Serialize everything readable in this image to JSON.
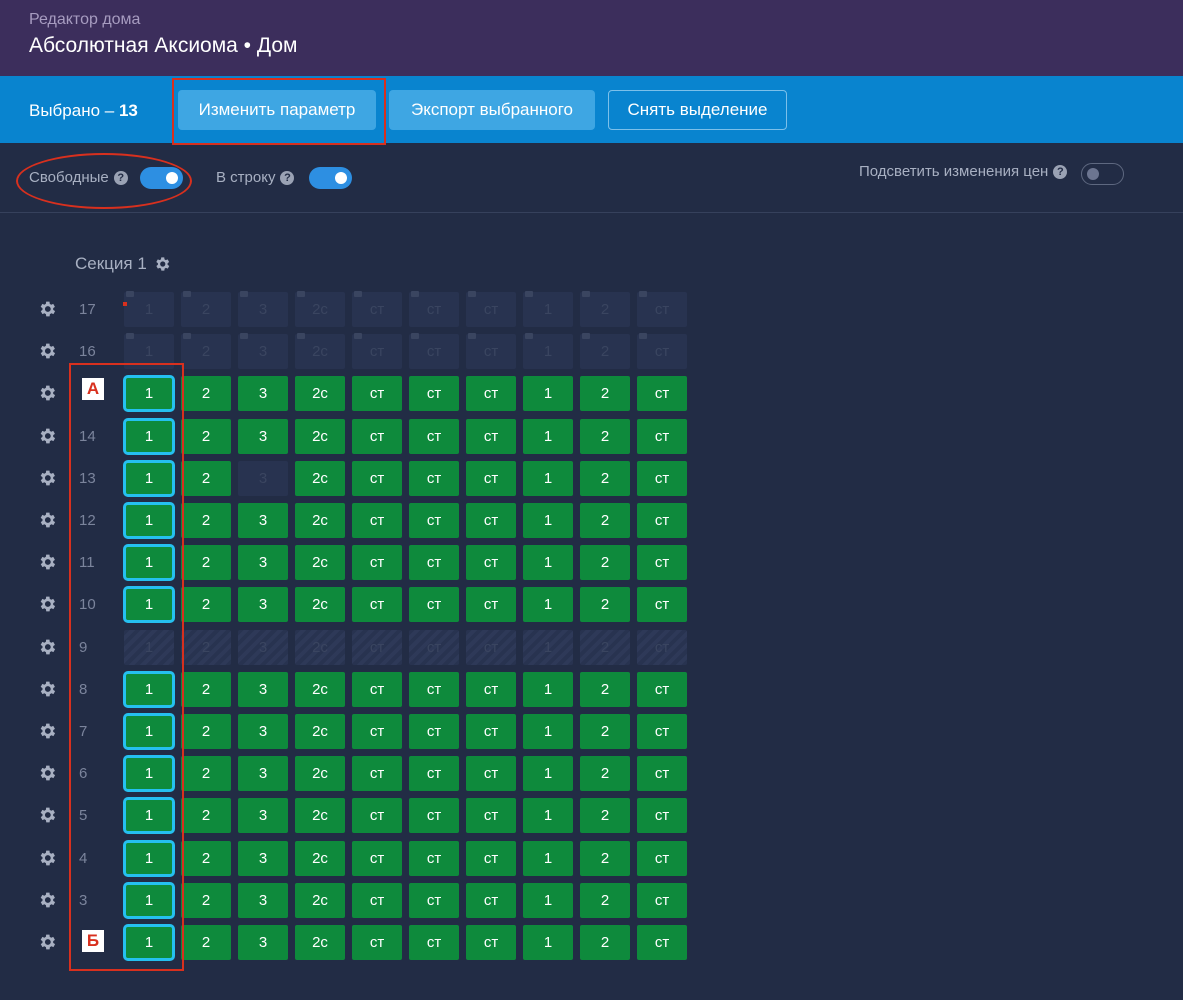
{
  "header": {
    "subtitle": "Редактор дома",
    "title": "Абсолютная Аксиома • Дом"
  },
  "toolbar": {
    "selected_label": "Выбрано –",
    "selected_count": "13",
    "change_param": "Изменить параметр",
    "export_selected": "Экспорт выбранного",
    "clear_selection": "Снять выделение"
  },
  "filters": {
    "free_label": "Свободные",
    "free_on": true,
    "inline_label": "В строку",
    "inline_on": true,
    "highlight_label": "Подсветить изменения цен",
    "highlight_on": false
  },
  "section": {
    "title": "Секция 1"
  },
  "annotations": {
    "top": "А",
    "bottom": "Б"
  },
  "colors": {
    "green": "#0e8a3c",
    "selected_outline": "#25c0f0",
    "annotation": "#d8301e"
  },
  "apartments": [
    "1",
    "2",
    "3",
    "2с",
    "ст",
    "ст",
    "ст",
    "1",
    "2",
    "ст"
  ],
  "floors": [
    {
      "num": "17",
      "state": "note"
    },
    {
      "num": "16",
      "state": "note"
    },
    {
      "num": "",
      "state": "active",
      "selected_col": 0
    },
    {
      "num": "14",
      "state": "active",
      "selected_col": 0
    },
    {
      "num": "13",
      "state": "active",
      "selected_col": 0,
      "dim_cols": [
        2
      ]
    },
    {
      "num": "12",
      "state": "active",
      "selected_col": 0
    },
    {
      "num": "11",
      "state": "active",
      "selected_col": 0
    },
    {
      "num": "10",
      "state": "active",
      "selected_col": 0
    },
    {
      "num": "9",
      "state": "hatch"
    },
    {
      "num": "8",
      "state": "active",
      "selected_col": 0
    },
    {
      "num": "7",
      "state": "active",
      "selected_col": 0
    },
    {
      "num": "6",
      "state": "active",
      "selected_col": 0
    },
    {
      "num": "5",
      "state": "active",
      "selected_col": 0
    },
    {
      "num": "4",
      "state": "active",
      "selected_col": 0
    },
    {
      "num": "3",
      "state": "active",
      "selected_col": 0
    },
    {
      "num": "",
      "state": "active",
      "selected_col": 0
    }
  ]
}
